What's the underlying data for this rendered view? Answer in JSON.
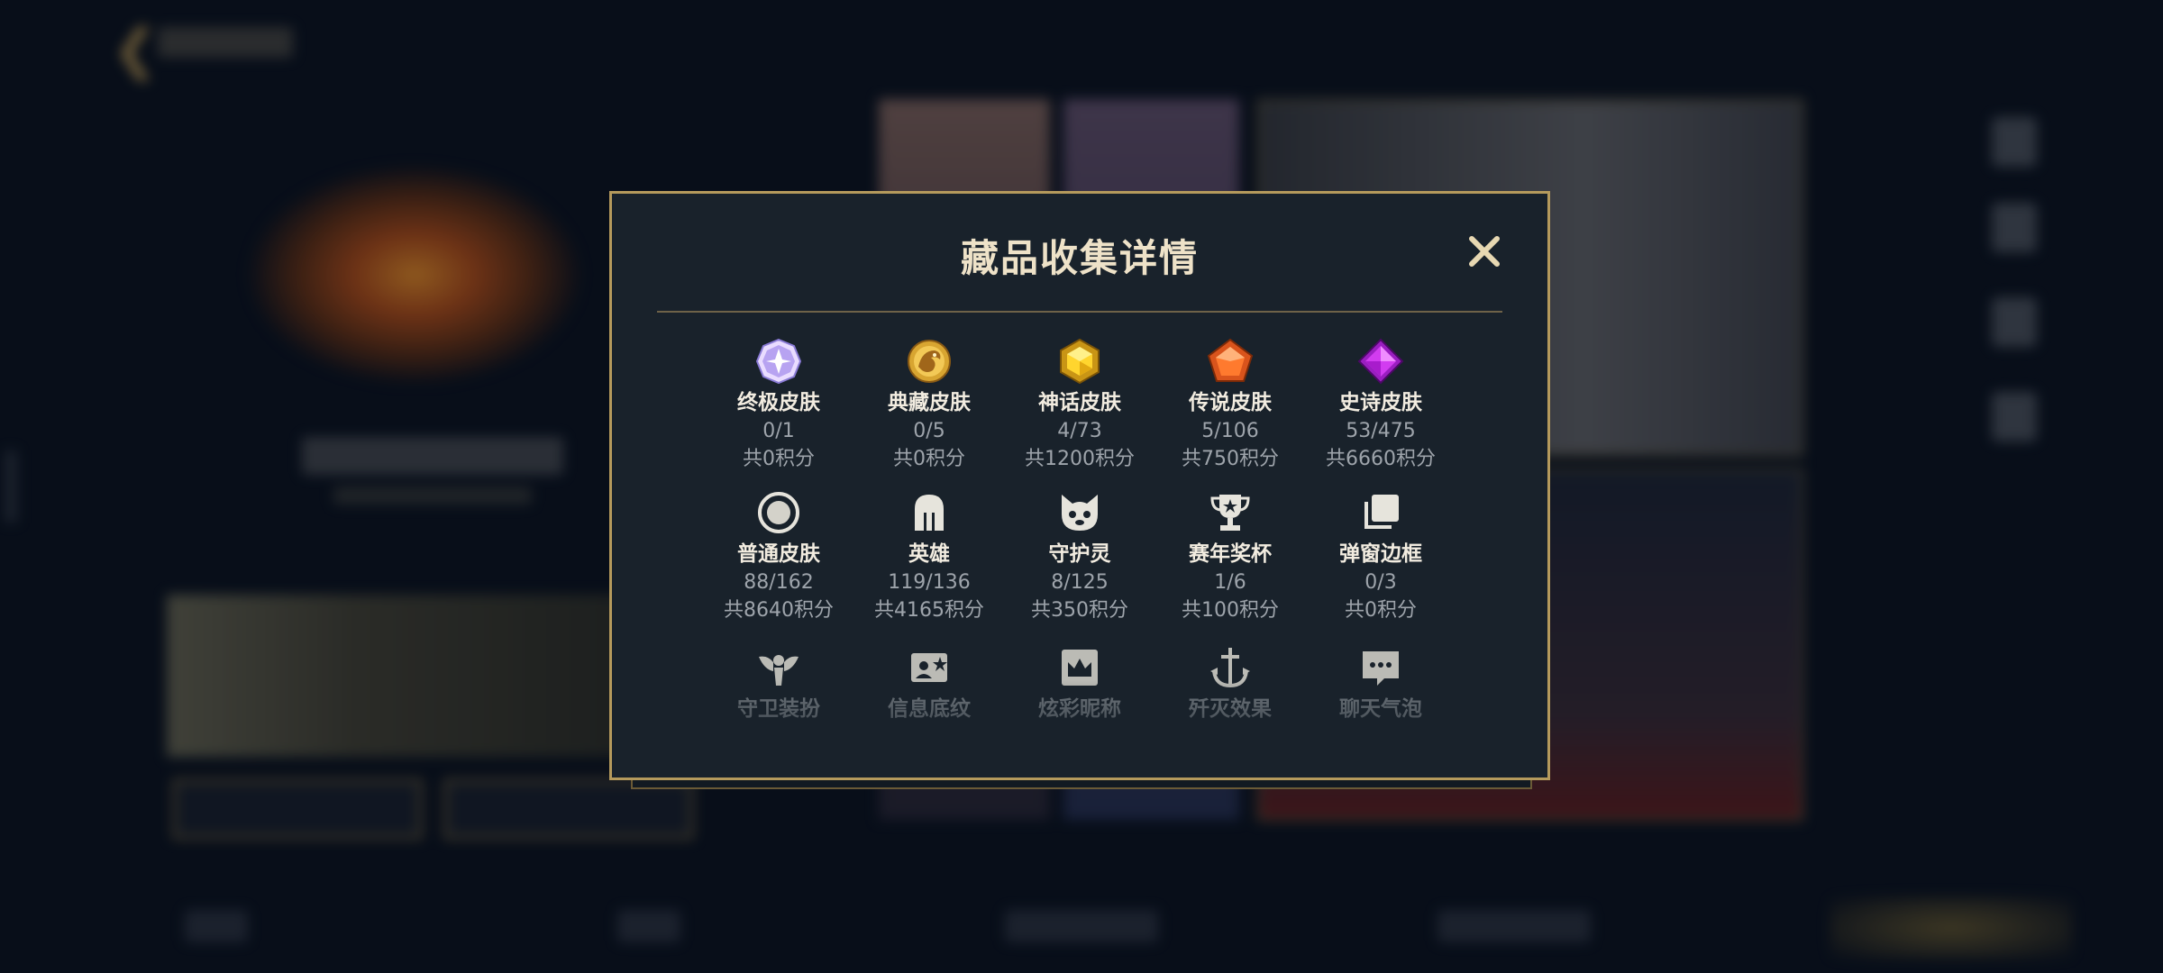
{
  "modal": {
    "title": "藏品收集详情",
    "close_label": "×"
  },
  "rows": [
    [
      {
        "name": "终极皮肤",
        "count": "0/1",
        "points": "共0积分",
        "icon": "ultimate-skin-gem-icon"
      },
      {
        "name": "典藏皮肤",
        "count": "0/5",
        "points": "共0积分",
        "icon": "collector-dragon-icon"
      },
      {
        "name": "神话皮肤",
        "count": "4/73",
        "points": "共1200积分",
        "icon": "mythic-gem-icon"
      },
      {
        "name": "传说皮肤",
        "count": "5/106",
        "points": "共750积分",
        "icon": "legendary-gem-icon"
      },
      {
        "name": "史诗皮肤",
        "count": "53/475",
        "points": "共6660积分",
        "icon": "epic-gem-icon"
      }
    ],
    [
      {
        "name": "普通皮肤",
        "count": "88/162",
        "points": "共8640积分",
        "icon": "common-skin-ring-icon"
      },
      {
        "name": "英雄",
        "count": "119/136",
        "points": "共4165积分",
        "icon": "hero-helmet-icon"
      },
      {
        "name": "守护灵",
        "count": "8/125",
        "points": "共350积分",
        "icon": "guardian-spirit-icon"
      },
      {
        "name": "赛年奖杯",
        "count": "1/6",
        "points": "共100积分",
        "icon": "trophy-icon"
      },
      {
        "name": "弹窗边框",
        "count": "0/3",
        "points": "共0积分",
        "icon": "popup-frame-icon"
      }
    ],
    [
      {
        "name": "守卫装扮",
        "icon": "ward-skin-icon"
      },
      {
        "name": "信息底纹",
        "icon": "info-card-icon"
      },
      {
        "name": "炫彩昵称",
        "icon": "nickname-crown-icon"
      },
      {
        "name": "歼灭效果",
        "icon": "elimination-effect-icon"
      },
      {
        "name": "聊天气泡",
        "icon": "chat-bubble-icon"
      }
    ]
  ],
  "colors": {
    "accent_gold": "#b59a5c",
    "modal_bg": "#19222b",
    "title_text": "#eee2c8",
    "label_text": "#f2ece0",
    "muted_text": "#9ea4ab"
  }
}
